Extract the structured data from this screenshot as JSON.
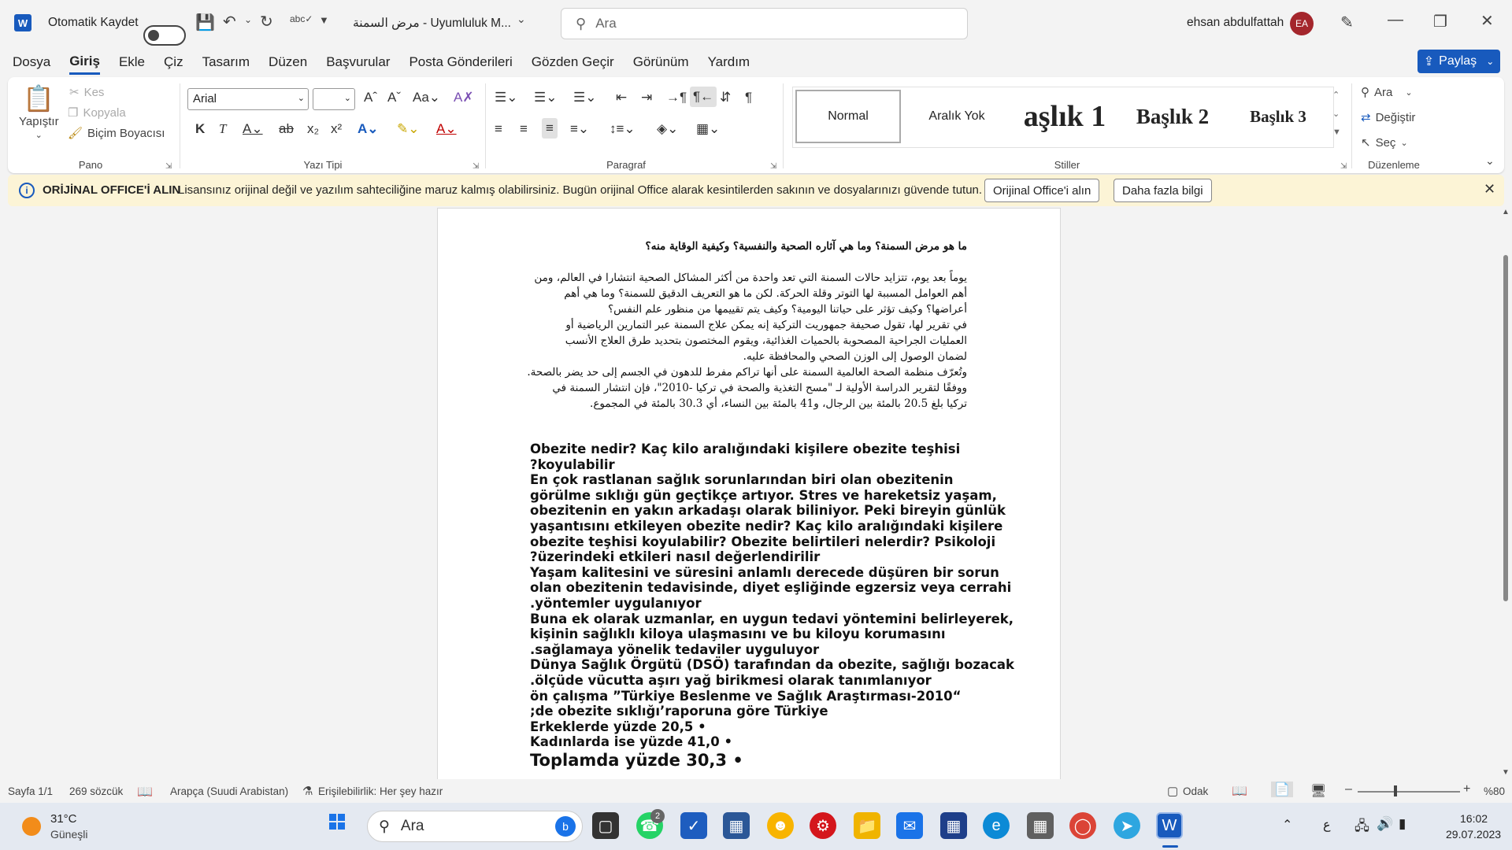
{
  "titlebar": {
    "autosave_label": "Otomatik Kaydet",
    "doc_title": "مرض السمنة  -  Uyumluluk M...",
    "search_placeholder": "Ara",
    "user_name": "ehsan abdulfattah",
    "user_initials": "EA"
  },
  "menu": {
    "items": [
      "Dosya",
      "Giriş",
      "Ekle",
      "Çiz",
      "Tasarım",
      "Düzen",
      "Başvurular",
      "Posta Gönderileri",
      "Gözden Geçir",
      "Görünüm",
      "Yardım"
    ],
    "share_label": "Paylaş"
  },
  "ribbon": {
    "clipboard": {
      "paste": "Yapıştır",
      "cut": "Kes",
      "copy": "Kopyala",
      "format_painter": "Biçim Boyacısı",
      "label": "Pano"
    },
    "font": {
      "font_name": "Arial",
      "font_size": "",
      "label": "Yazı Tipi"
    },
    "paragraph": {
      "label": "Paragraf"
    },
    "styles": {
      "items": [
        "Normal",
        "Aralık Yok",
        "aşlık 1",
        "Başlık 2",
        "Başlık 3"
      ],
      "label": "Stiller"
    },
    "editing": {
      "find": "Ara",
      "replace": "Değiştir",
      "select": "Seç",
      "label": "Düzenleme"
    }
  },
  "infobar": {
    "title": "ORİJİNAL OFFICE'İ ALIN",
    "message": "Lisansınız orijinal değil ve yazılım sahteciliğine maruz kalmış olabilirsiniz. Bugün orijinal Office alarak kesintilerden sakının ve dosyalarınızı güvende tutun.",
    "button_primary": "Orijinal Office'i alın",
    "button_secondary": "Daha fazla bilgi"
  },
  "document": {
    "arabic_title": "ما هو مرض السمنة؟ وما هي آثاره الصحية والنفسية؟ وكيفية الوقاية منه؟",
    "arabic_lines": [
      "يوماً بعد يوم، تتزايد حالات السمنة التي تعد واحدة من أكثر المشاكل الصحية انتشارا في العالم، ومن",
      "أهم العوامل المسببة لها التوتر وقلة الحركة. لكن ما هو التعريف الدقيق للسمنة؟ وما هي أهم",
      "أعراضها؟ وكيف تؤثر على حياتنا اليومية؟ وكيف يتم تقييمها من منظور علم النفس؟",
      "في تقرير لها، تقول صحيفة جمهوريت التركية إنه يمكن علاج السمنة عبر التمارين الرياضية أو",
      "العمليات الجراحية المصحوبة بالحميات الغذائية، ويقوم المختصون بتحديد طرق العلاج الأنسب",
      "لضمان الوصول إلى الوزن الصحي والمحافظة عليه.",
      "وتُعرّف منظمة الصحة العالمية السمنة على أنها تراكم مفرط للدهون في الجسم إلى حد يضر بالصحة.",
      "ووفقًا لتقرير الدراسة الأولية لـ \"مسح التغذية والصحة في تركيا -2010\"، فإن انتشار السمنة في",
      "تركيا بلغ 20.5 بالمئة بين الرجال، و41 بالمئة بين النساء، أي 30.3 بالمئة في المجموع."
    ],
    "turkish_lines": [
      "Obezite nedir? Kaç kilo aralığındaki kişilere obezite teşhisi",
      "?koyulabilir",
      "En çok rastlanan sağlık sorunlarından biri olan obezitenin",
      "görülme sıklığı gün geçtikçe artıyor. Stres ve hareketsiz yaşam,",
      "obezitenin en yakın arkadaşı olarak biliniyor. Peki bireyin günlük",
      "yaşantısını etkileyen obezite nedir? Kaç kilo aralığındaki kişilere",
      "obezite teşhisi koyulabilir? Obezite belirtileri nelerdir? Psikoloji",
      "?üzerindeki etkileri nasıl değerlendirilir",
      "Yaşam kalitesini ve süresini anlamlı derecede düşüren bir sorun",
      "olan obezitenin tedavisinde, diyet eşliğinde egzersiz veya cerrahi",
      ".yöntemler uygulanıyor",
      "Buna ek olarak uzmanlar, en uygun tedavi yöntemini belirleyerek,",
      "kişinin sağlıklı kiloya ulaşmasını ve bu kiloyu korumasını",
      ".sağlamaya yönelik tedaviler uyguluyor",
      "Dünya Sağlık Örgütü (DSÖ) tarafından da obezite, sağlığı bozacak",
      ".ölçüde vücutta aşırı yağ birikmesi olarak tanımlanıyor",
      "ön çalışma  ”Türkiye Beslenme ve Sağlık Araştırması-2010“",
      ";de obezite sıklığı’raporuna göre Türkiye",
      "Erkeklerde yüzde 20,5 •",
      "Kadınlarda ise yüzde 41,0 •"
    ],
    "turkish_last": "Toplamda yüzde 30,3 •"
  },
  "statusbar": {
    "page": "Sayfa 1/1",
    "words": "269 sözcük",
    "language": "Arapça (Suudi Arabistan)",
    "accessibility": "Erişilebilirlik: Her şey hazır",
    "focus": "Odak",
    "zoom": "%80"
  },
  "taskbar": {
    "weather_temp": "31°C",
    "weather_desc": "Güneşli",
    "search_label": "Ara",
    "badge_count": "2",
    "time": "16:02",
    "date": "29.07.2023",
    "lang": "ع"
  },
  "colors": {
    "accent": "#185abd",
    "infobar_bg": "#fcf4d6",
    "avatar": "#a4262c"
  }
}
